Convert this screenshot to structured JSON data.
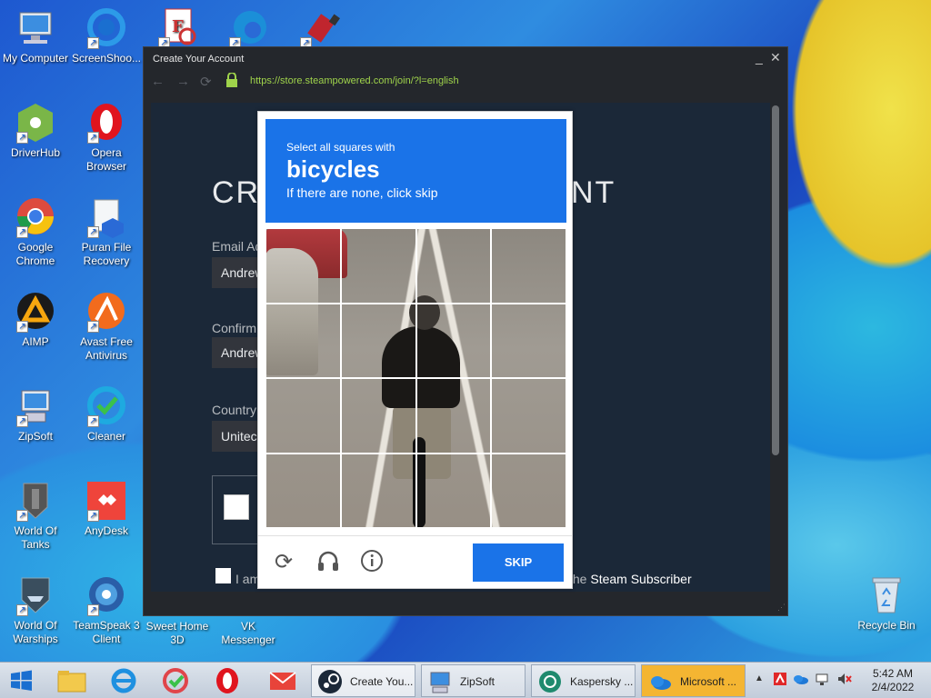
{
  "desktop": {
    "icons": [
      {
        "label": "My Computer",
        "icon": "computer-icon"
      },
      {
        "label": "ScreenShoo...",
        "icon": "screenshot-icon"
      },
      {
        "label": "",
        "icon": "foxit-icon"
      },
      {
        "label": "",
        "icon": "edge-icon"
      },
      {
        "label": "",
        "icon": "usb-icon"
      },
      {
        "label": "DriverHub",
        "icon": "driverhub-icon"
      },
      {
        "label": "Opera Browser",
        "icon": "opera-icon"
      },
      {
        "label": "Google Chrome",
        "icon": "chrome-icon"
      },
      {
        "label": "Puran File Recovery",
        "icon": "puran-icon"
      },
      {
        "label": "AIMP",
        "icon": "aimp-icon"
      },
      {
        "label": "Avast Free Antivirus",
        "icon": "avast-icon"
      },
      {
        "label": "ZipSoft",
        "icon": "zipsoft-icon"
      },
      {
        "label": "Cleaner",
        "icon": "cleaner-icon"
      },
      {
        "label": "World Of Tanks",
        "icon": "tanks-icon"
      },
      {
        "label": "AnyDesk",
        "icon": "anydesk-icon"
      },
      {
        "label": "World Of Warships",
        "icon": "warships-icon"
      },
      {
        "label": "TeamSpeak 3 Client",
        "icon": "teamspeak-icon"
      },
      {
        "label": "Sweet Home 3D",
        "icon": "sweethome-icon"
      },
      {
        "label": "VK Messenger",
        "icon": "vk-icon"
      },
      {
        "label": "Recycle Bin",
        "icon": "recycle-bin-icon"
      }
    ]
  },
  "window": {
    "title": "Create Your Account",
    "minimize": "_",
    "close": "✕",
    "url": "https://store.steampowered.com/join/?l=english"
  },
  "steam": {
    "heading_left": "CRE",
    "heading_right": "NT",
    "email_label": "Email Ad",
    "email_value": "Andrew",
    "confirm_label": "Confirm",
    "confirm_value": "Andrew",
    "country_label": "Country",
    "country_value": "Unitec",
    "agree_text": "I am",
    "subscriber_prefix": "the",
    "subscriber_bold": "Steam Subscriber"
  },
  "captcha": {
    "line1": "Select all squares with",
    "keyword": "bicycles",
    "line3": "If there are none, click skip",
    "skip_label": "SKIP",
    "grid_rows": 4,
    "grid_cols": 4
  },
  "taskbar": {
    "tasks": [
      {
        "label": "Create You...",
        "icon": "steam-icon"
      },
      {
        "label": "ZipSoft",
        "icon": "zipsoft-icon"
      },
      {
        "label": "Kaspersky ...",
        "icon": "kaspersky-icon"
      },
      {
        "label": "Microsoft ...",
        "icon": "onedrive-icon"
      }
    ],
    "time": "5:42 AM",
    "date": "2/4/2022"
  }
}
